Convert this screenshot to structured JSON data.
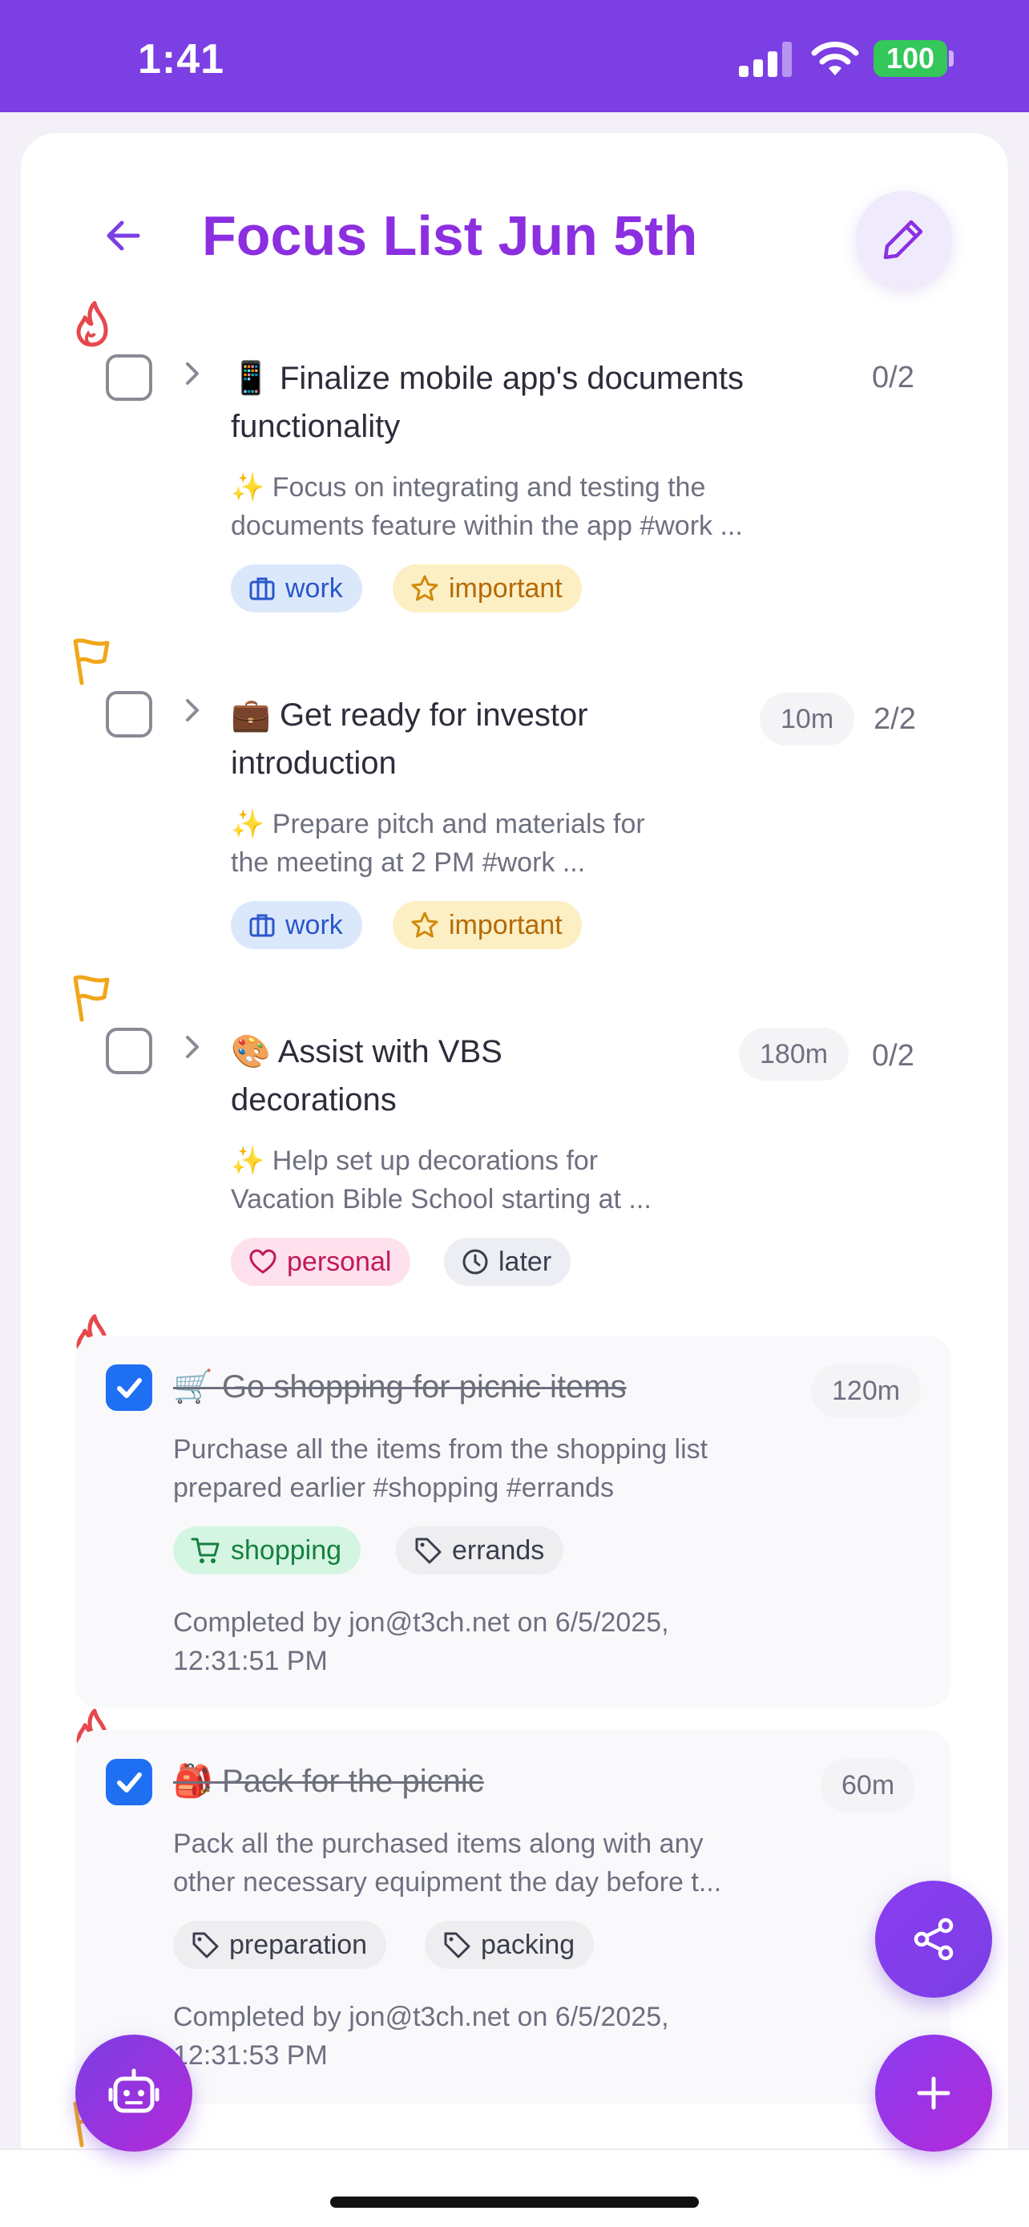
{
  "status_bar": {
    "time": "1:41",
    "battery": "100"
  },
  "header": {
    "title": "Focus List Jun 5th"
  },
  "tasks": [
    {
      "emoji": "📱",
      "title_line1": "Finalize mobile app's documents",
      "title_line2": "functionality",
      "count": "0/2",
      "priority_icon": "flame-icon",
      "desc_line1": "✨ Focus on integrating and testing the",
      "desc_line2": "documents feature within the app #work ...",
      "tags": [
        "work",
        "important"
      ]
    },
    {
      "emoji": "💼",
      "title_line1": "Get ready for investor",
      "title_line2": "introduction",
      "duration": "10m",
      "count": "2/2",
      "priority_icon": "flag-icon",
      "desc_line1": "✨ Prepare pitch and materials for",
      "desc_line2": "the meeting at 2 PM #work ...",
      "tags": [
        "work",
        "important"
      ]
    },
    {
      "emoji": "🎨",
      "title_line1": "Assist with VBS",
      "title_line2": "decorations",
      "duration": "180m",
      "count": "0/2",
      "priority_icon": "flag-icon",
      "desc_line1": "✨ Help set up decorations for",
      "desc_line2": "Vacation Bible School starting at ...",
      "tags": [
        "personal",
        "later"
      ]
    }
  ],
  "completed_tasks": [
    {
      "emoji": "🛒",
      "title": "Go shopping for picnic items",
      "duration": "120m",
      "priority_icon": "flame-icon",
      "desc_line1": "Purchase all the items from the shopping list",
      "desc_line2": "prepared earlier #shopping #errands",
      "tags": [
        "shopping",
        "errands"
      ],
      "completed_line1": "Completed by jon@t3ch.net on 6/5/2025,",
      "completed_line2": "12:31:51 PM"
    },
    {
      "emoji": "🎒",
      "title": "Pack for the picnic",
      "duration": "60m",
      "priority_icon": "flame-icon",
      "desc_line1": "Pack all the purchased items along with any",
      "desc_line2": "other necessary equipment the day before t...",
      "tags": [
        "preparation",
        "packing"
      ],
      "completed_line1": "Completed by jon@t3ch.net on 6/5/2025,",
      "completed_line2": "12:31:53 PM"
    }
  ],
  "colors": {
    "accent": "#7b3fe4",
    "title": "#8b2fe0",
    "check": "#1f6ff2",
    "flame": "#e5484d",
    "flag": "#f0a71a"
  }
}
